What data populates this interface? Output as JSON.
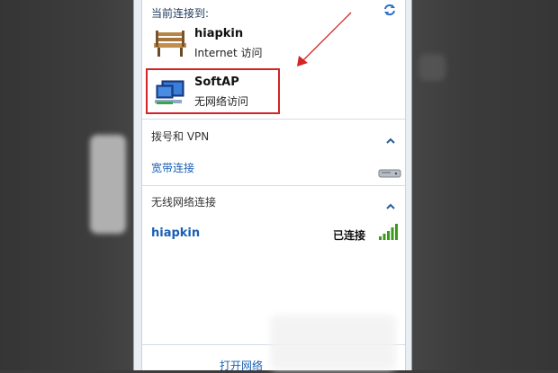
{
  "panel": {
    "header": "当前连接到:",
    "current_connections": [
      {
        "name": "hiapkin",
        "status": "Internet 访问",
        "icon": "bench-icon"
      },
      {
        "name": "SoftAP",
        "status": "无网络访问",
        "icon": "network-computer-icon"
      }
    ],
    "dialup_section": {
      "title": "拨号和 VPN",
      "item": "宽带连接"
    },
    "wireless_section": {
      "title": "无线网络连接",
      "network": {
        "name": "hiapkin",
        "status": "已连接",
        "signal_bars": 5
      }
    },
    "footer_link": "打开网络"
  },
  "colors": {
    "link": "#1a5fb4",
    "highlight": "#d42426",
    "signal": "#3c9a1a"
  }
}
